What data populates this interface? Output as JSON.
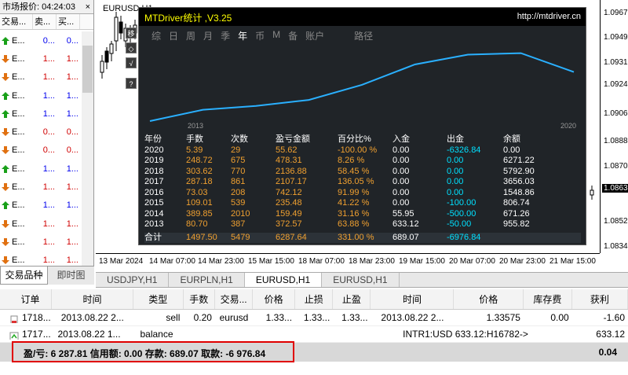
{
  "market_watch": {
    "title": "市场报价: 04:24:03",
    "close": "×",
    "cols": [
      "交易...",
      "卖...",
      "买..."
    ],
    "rows": [
      {
        "dir": "up",
        "sym": "E...",
        "bid": "0...",
        "ask": "0..."
      },
      {
        "dir": "dn",
        "sym": "E...",
        "bid": "1...",
        "ask": "1..."
      },
      {
        "dir": "dn",
        "sym": "E...",
        "bid": "1...",
        "ask": "1..."
      },
      {
        "dir": "up",
        "sym": "E...",
        "bid": "1...",
        "ask": "1..."
      },
      {
        "dir": "up",
        "sym": "E...",
        "bid": "1...",
        "ask": "1..."
      },
      {
        "dir": "dn",
        "sym": "E...",
        "bid": "0...",
        "ask": "0..."
      },
      {
        "dir": "dn",
        "sym": "E...",
        "bid": "0...",
        "ask": "0..."
      },
      {
        "dir": "up",
        "sym": "E...",
        "bid": "1...",
        "ask": "1..."
      },
      {
        "dir": "dn",
        "sym": "E...",
        "bid": "1...",
        "ask": "1..."
      },
      {
        "dir": "up",
        "sym": "E...",
        "bid": "1...",
        "ask": "1..."
      },
      {
        "dir": "dn",
        "sym": "E...",
        "bid": "1...",
        "ask": "1..."
      },
      {
        "dir": "dn",
        "sym": "E...",
        "bid": "1...",
        "ask": "1..."
      },
      {
        "dir": "dn",
        "sym": "E...",
        "bid": "1...",
        "ask": "1..."
      }
    ],
    "tabs": [
      "交易品种",
      "即时图"
    ]
  },
  "chart": {
    "symbol": "EURUSD,H1",
    "prices": [
      "1.09670",
      "1.09490",
      "1.09310",
      "1.09240",
      "1.09060",
      "1.08880",
      "1.08700",
      "1.08630",
      "1.08520",
      "1.08340"
    ],
    "times": [
      "13 Mar 2024",
      "14 Mar 07:00",
      "14 Mar 23:00",
      "15 Mar 15:00",
      "18 Mar 07:00",
      "18 Mar 23:00",
      "19 Mar 15:00",
      "20 Mar 07:00",
      "20 Mar 23:00",
      "21 Mar 15:00"
    ]
  },
  "tool": {
    "title": "MTDriver统计 ,V3.25",
    "url": "http://mtdriver.cn",
    "menu": [
      "综",
      "日",
      "周",
      "月",
      "季",
      "年",
      "币",
      "M",
      "备",
      "账户",
      "路径"
    ],
    "year_start": "2013",
    "year_end": "2020",
    "headers": [
      "年份",
      "手数",
      "次数",
      "盈亏金额",
      "百分比%",
      "入金",
      "出金",
      "余额"
    ],
    "rows": [
      [
        "2020",
        "5.39",
        "29",
        "55.62",
        "-100.00 %",
        "0.00",
        "-6326.84",
        "0.00"
      ],
      [
        "2019",
        "248.72",
        "675",
        "478.31",
        "8.26 %",
        "0.00",
        "0.00",
        "6271.22"
      ],
      [
        "2018",
        "303.62",
        "770",
        "2136.88",
        "58.45 %",
        "0.00",
        "0.00",
        "5792.90"
      ],
      [
        "2017",
        "287.18",
        "861",
        "2107.17",
        "136.05 %",
        "0.00",
        "0.00",
        "3656.03"
      ],
      [
        "2016",
        "73.03",
        "208",
        "742.12",
        "91.99 %",
        "0.00",
        "0.00",
        "1548.86"
      ],
      [
        "2015",
        "109.01",
        "539",
        "235.48",
        "41.22 %",
        "0.00",
        "-100.00",
        "806.74"
      ],
      [
        "2014",
        "389.85",
        "2010",
        "159.49",
        "31.16 %",
        "55.95",
        "-500.00",
        "671.26"
      ],
      [
        "2013",
        "80.70",
        "387",
        "372.57",
        "63.88 %",
        "633.12",
        "-50.00",
        "955.82"
      ]
    ],
    "total": [
      "合计",
      "1497.50",
      "5479",
      "6287.64",
      "331.00 %",
      "689.07",
      "-6976.84",
      ""
    ],
    "curve": [
      0.0,
      0.15,
      0.2,
      0.28,
      0.48,
      0.75,
      0.88,
      0.9,
      0.65
    ]
  },
  "chart_tabs": [
    "USDJPY,H1",
    "EURPLN,H1",
    "EURUSD,H1",
    "EURUSD,H1"
  ],
  "terminal": {
    "headers": [
      "订单",
      "时间",
      "类型",
      "手数",
      "交易...",
      "价格",
      "止损",
      "止盈",
      "时间",
      "价格",
      "库存费",
      "获利"
    ],
    "rows": [
      [
        "1718...",
        "2013.08.22 2...",
        "sell",
        "0.20",
        "eurusd",
        "1.33...",
        "1.33...",
        "1.33...",
        "2013.08.22 2...",
        "1.33575",
        "0.00",
        "-1.60"
      ],
      [
        "1717...",
        "2013.08.22 1...",
        "balance",
        "",
        "",
        "",
        "",
        "",
        "INTR1:USD 633.12:H16782->",
        "",
        "",
        "633.12"
      ]
    ],
    "summary": "盈/亏: 6 287.81  信用额: 0.00  存款: 689.07  取款: -6 976.84",
    "total": "0.04"
  }
}
